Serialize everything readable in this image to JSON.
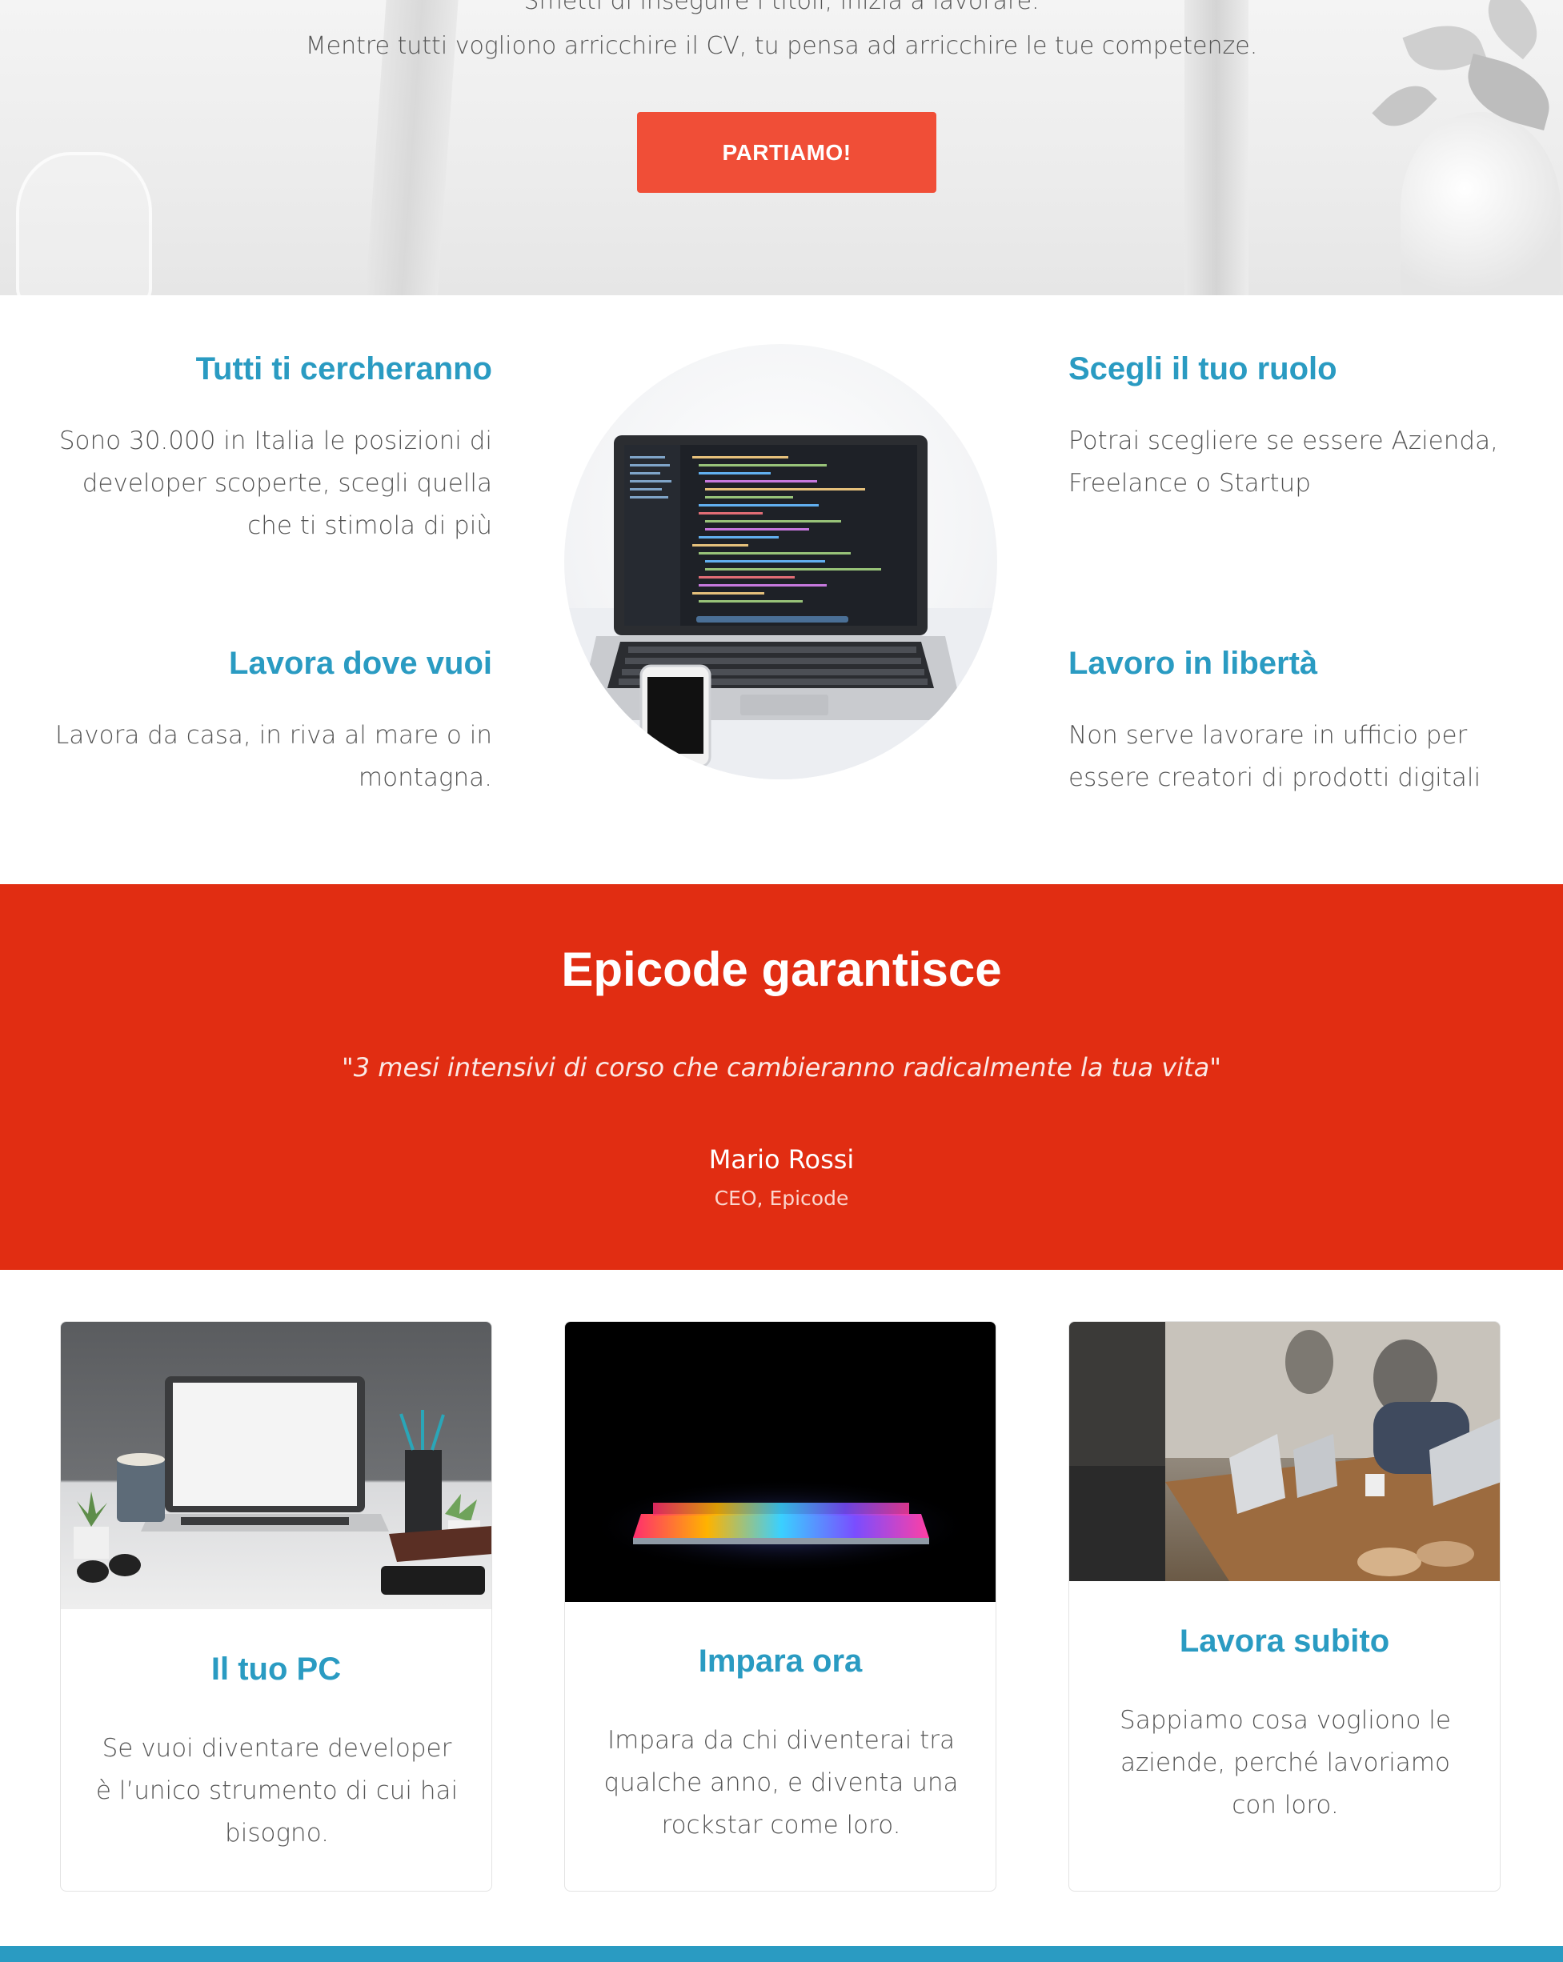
{
  "hero": {
    "line1": "Smetti di inseguire i titoli, inizia a lavorare.",
    "line2": "Mentre tutti vogliono arricchire il CV, tu pensa ad arricchire le tue competenze.",
    "cta_label": "PARTIAMO!"
  },
  "features": [
    {
      "title": "Tutti ti cercheranno",
      "text": "Sono 30.000 in Italia le posizioni di developer scoperte, scegli quella che ti stimola di più"
    },
    {
      "title": "Lavora dove vuoi",
      "text": "Lavora da casa, in riva al mare o in montagna."
    },
    {
      "title": "Scegli il tuo ruolo",
      "text": "Potrai scegliere se essere Azienda, Freelance o Startup"
    },
    {
      "title": "Lavoro in libertà",
      "text": "Non serve lavorare in ufficio per essere creatori di prodotti digitali"
    }
  ],
  "testimonial": {
    "title": "Epicode garantisce",
    "quote": "\"3 mesi intensivi di corso che cambieranno radicalmente la tua vita\"",
    "author": "Mario Rossi",
    "role": "CEO, Epicode"
  },
  "cards": [
    {
      "title": "Il tuo PC",
      "text": "Se vuoi diventare developer è l’unico strumento di cui hai bisogno."
    },
    {
      "title": "Impara ora",
      "text": "Impara da chi diventerai tra qualche anno, e diventa una rockstar come loro."
    },
    {
      "title": "Lavora subito",
      "text": "Sappiamo cosa vogliono le aziende, perché lavoriamo con loro."
    }
  ],
  "colors": {
    "accent_blue": "#2a9bc2",
    "cta_orange": "#f04e37",
    "testimonial_red": "#e12d12"
  }
}
